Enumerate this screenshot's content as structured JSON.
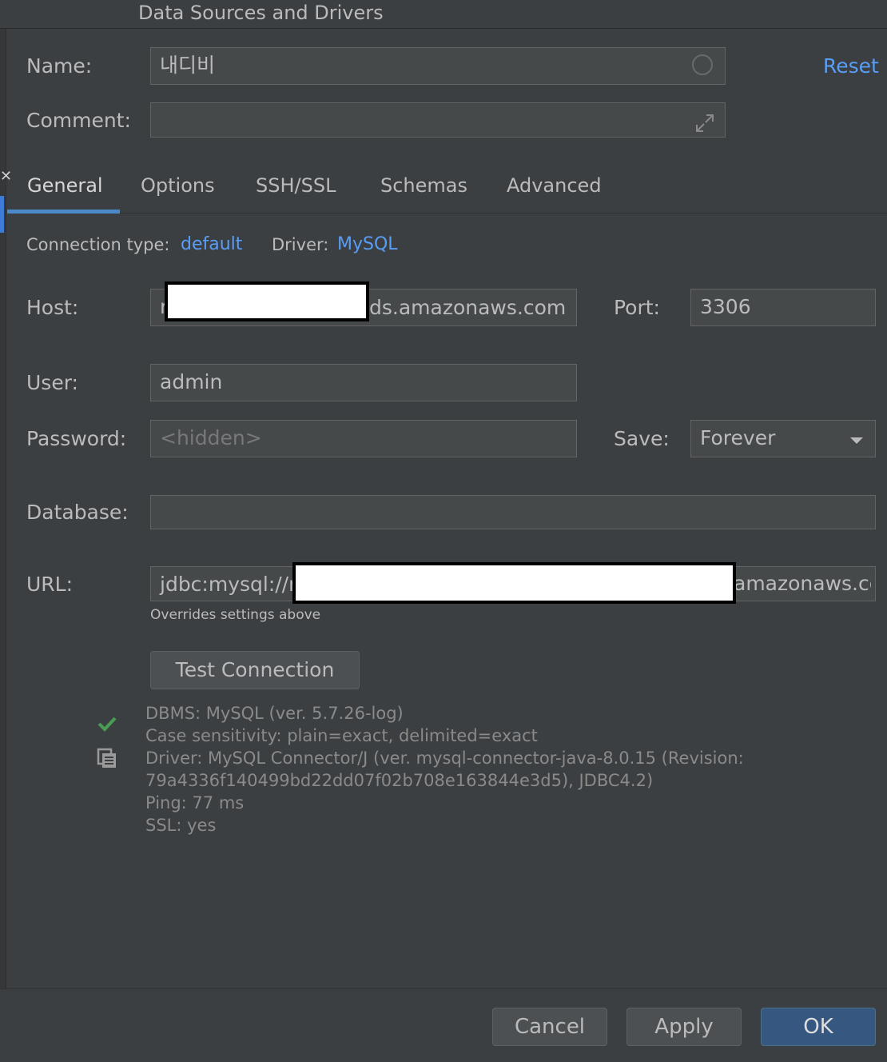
{
  "window": {
    "title": "Data Sources and Drivers"
  },
  "form": {
    "name_label": "Name:",
    "name_value": "내디비",
    "reset_label": "Reset",
    "comment_label": "Comment:",
    "comment_value": ""
  },
  "tabs": [
    {
      "label": "General",
      "active": true
    },
    {
      "label": "Options",
      "active": false
    },
    {
      "label": "SSH/SSL",
      "active": false
    },
    {
      "label": "Schemas",
      "active": false
    },
    {
      "label": "Advanced",
      "active": false
    }
  ],
  "connection": {
    "type_label": "Connection type:",
    "type_value": "default",
    "driver_label": "Driver:",
    "driver_value": "MySQL"
  },
  "general": {
    "host_label": "Host:",
    "host_prefix": "r",
    "host_value": "ds.amazonaws.com",
    "port_label": "Port:",
    "port_value": "3306",
    "user_label": "User:",
    "user_value": "admin",
    "password_label": "Password:",
    "password_placeholder": "<hidden>",
    "save_label": "Save:",
    "save_value": "Forever",
    "database_label": "Database:",
    "database_value": "",
    "url_label": "URL:",
    "url_prefix": "jdbc:mysql://r",
    "url_suffix": "amazonaws.co",
    "url_hint": "Overrides settings above",
    "test_button": "Test Connection"
  },
  "result": {
    "lines": [
      "DBMS: MySQL (ver. 5.7.26-log)",
      "Case sensitivity: plain=exact, delimited=exact",
      "Driver: MySQL Connector/J (ver. mysql-connector-java-8.0.15 (Revision:",
      "79a4336f140499bd22dd07f02b708e163844e3d5), JDBC4.2)",
      "Ping: 77 ms",
      "SSL: yes"
    ]
  },
  "footer": {
    "cancel": "Cancel",
    "apply": "Apply",
    "ok": "OK"
  },
  "colors": {
    "background": "#3c3f41",
    "link": "#589df6",
    "success": "#499c54",
    "primary_button": "#365880"
  },
  "icons": {
    "name_field": "circle-icon",
    "comment_field": "expand-icon",
    "save_select": "chevron-down-icon",
    "status": "checkmark-icon",
    "copy": "copy-icon"
  }
}
